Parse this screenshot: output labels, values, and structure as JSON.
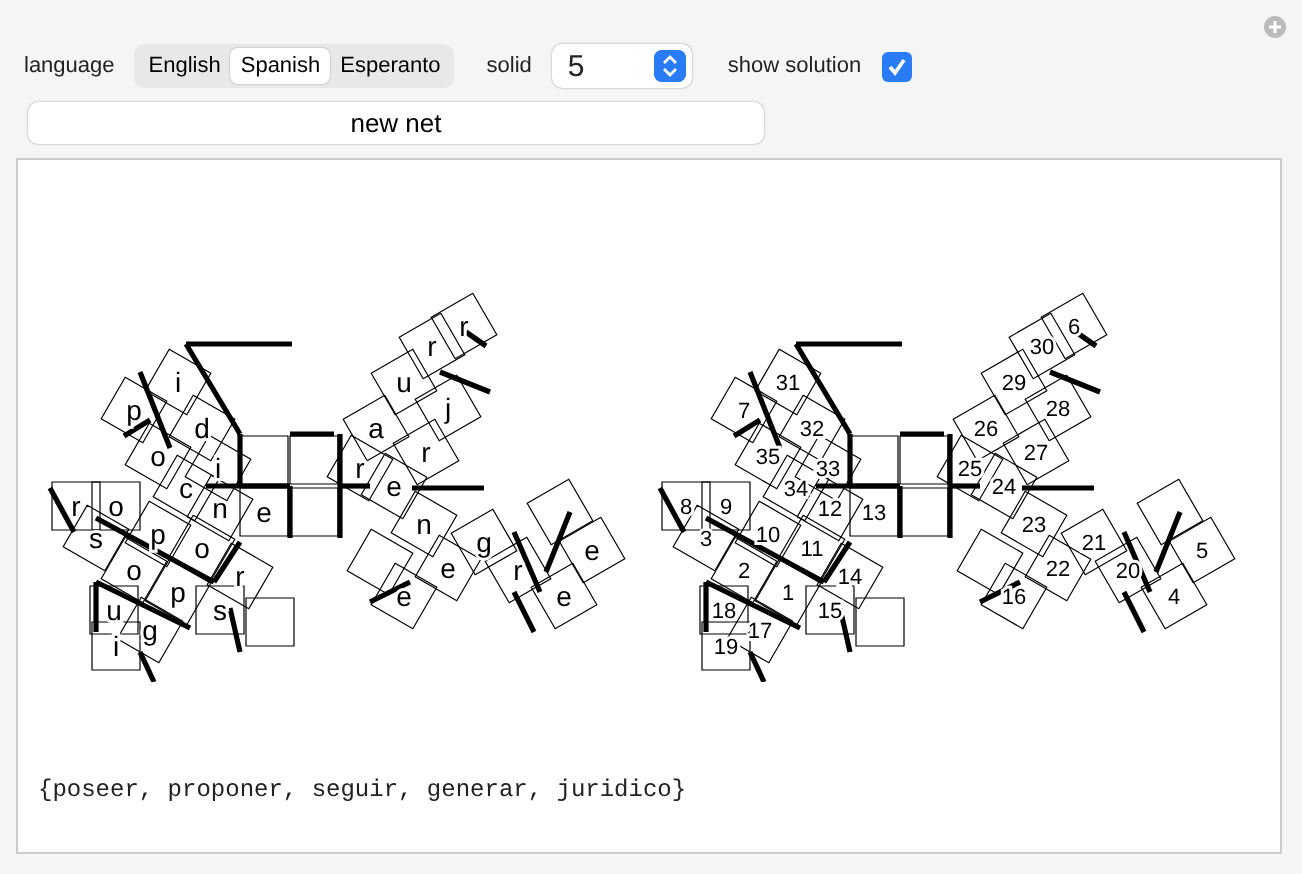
{
  "controls": {
    "language": {
      "label": "language",
      "options": [
        {
          "label": "English",
          "selected": false
        },
        {
          "label": "Spanish",
          "selected": true
        },
        {
          "label": "Esperanto",
          "selected": false
        }
      ]
    },
    "solid": {
      "label": "solid",
      "value": "5"
    },
    "show_solution": {
      "label": "show solution",
      "checked": true
    },
    "button": "new net"
  },
  "nets": [
    {
      "kind": "letters",
      "cells": [
        "p",
        "o",
        "s",
        "e",
        "e",
        "r",
        "p",
        "r",
        "o",
        "p",
        "o",
        "n",
        "e",
        "r",
        "s",
        "e",
        "g",
        "u",
        "i",
        "r",
        "g",
        "e",
        "n",
        "e",
        "r",
        "a",
        "r",
        "j",
        "u",
        "r",
        "i",
        "d",
        "i",
        "c",
        "o"
      ]
    },
    {
      "kind": "numbers",
      "cells": [
        "1",
        "2",
        "3",
        "4",
        "5",
        "6",
        "7",
        "8",
        "9",
        "10",
        "11",
        "12",
        "13",
        "14",
        "15",
        "16",
        "17",
        "18",
        "19",
        "20",
        "21",
        "22",
        "23",
        "24",
        "25",
        "26",
        "27",
        "28",
        "29",
        "30",
        "31",
        "32",
        "33",
        "34",
        "35"
      ]
    }
  ],
  "result": "{poseer, proponer, seguir, generar, juridico}"
}
